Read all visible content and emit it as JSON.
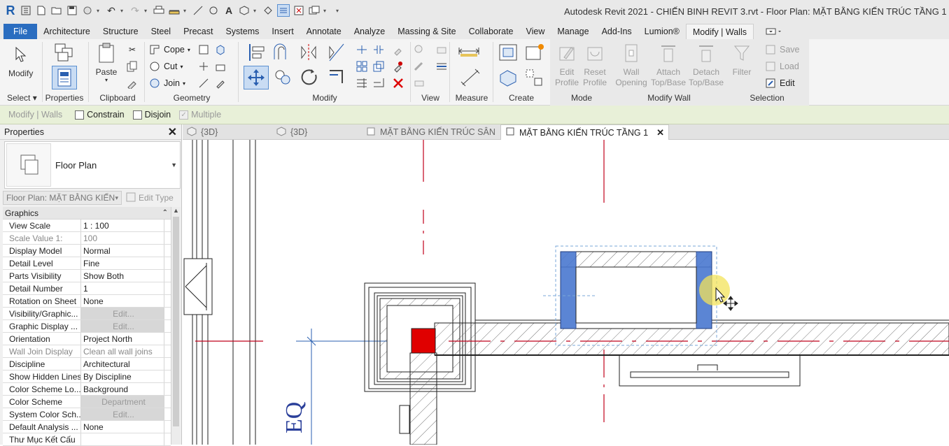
{
  "window": {
    "title": "Autodesk Revit 2021 - CHIẾN BINH REVIT 3.rvt - Floor Plan: MẶT BẰNG KIẾN TRÚC TẦNG 1"
  },
  "menu": {
    "file": "File",
    "tabs": [
      "Architecture",
      "Structure",
      "Steel",
      "Precast",
      "Systems",
      "Insert",
      "Annotate",
      "Analyze",
      "Massing & Site",
      "Collaborate",
      "View",
      "Manage",
      "Add-Ins",
      "Lumion®",
      "Modify | Walls"
    ]
  },
  "ribbon": {
    "select": {
      "modify": "Modify",
      "label": "Select"
    },
    "properties": {
      "label": "Properties"
    },
    "clipboard": {
      "paste": "Paste",
      "label": "Clipboard"
    },
    "geometry": {
      "cope": "Cope",
      "cut": "Cut",
      "join": "Join",
      "label": "Geometry"
    },
    "modify_label": "Modify",
    "view_label": "View",
    "measure_label": "Measure",
    "create_label": "Create",
    "mode": {
      "edit_profile": "Edit Profile",
      "reset_profile": "Reset Profile",
      "label": "Mode"
    },
    "modify_wall": {
      "wall_opening": "Wall Opening",
      "attach": "Attach Top/Base",
      "detach": "Detach Top/Base",
      "label": "Modify Wall"
    },
    "selection": {
      "filter": "Filter",
      "save": "Save",
      "load": "Load",
      "edit": "Edit",
      "label": "Selection"
    }
  },
  "options_bar": {
    "context": "Modify | Walls",
    "constrain": "Constrain",
    "disjoin": "Disjoin",
    "multiple": "Multiple"
  },
  "properties": {
    "title": "Properties",
    "type_name": "Floor Plan",
    "instance_selector": "Floor Plan: MẶT BẰNG KIẾN",
    "edit_type": "Edit Type",
    "category": "Graphics",
    "rows": [
      {
        "name": "View Scale",
        "value": "1 : 100"
      },
      {
        "name": "Scale Value    1:",
        "value": "100"
      },
      {
        "name": "Display Model",
        "value": "Normal"
      },
      {
        "name": "Detail Level",
        "value": "Fine"
      },
      {
        "name": "Parts Visibility",
        "value": "Show Both"
      },
      {
        "name": "Detail Number",
        "value": "1"
      },
      {
        "name": "Rotation on Sheet",
        "value": "None"
      },
      {
        "name": "Visibility/Graphic...",
        "value": "Edit..."
      },
      {
        "name": "Graphic Display ...",
        "value": "Edit..."
      },
      {
        "name": "Orientation",
        "value": "Project North"
      },
      {
        "name": "Wall Join Display",
        "value": "Clean all wall joins"
      },
      {
        "name": "Discipline",
        "value": "Architectural"
      },
      {
        "name": "Show Hidden Lines",
        "value": "By Discipline"
      },
      {
        "name": "Color Scheme Lo...",
        "value": "Background"
      },
      {
        "name": "Color Scheme",
        "value": "Department"
      },
      {
        "name": "System Color Sch...",
        "value": "Edit..."
      },
      {
        "name": "Default Analysis ...",
        "value": "None"
      },
      {
        "name": "Thư Mục Kết Cấu",
        "value": ""
      }
    ]
  },
  "view_tabs": [
    {
      "label": "{3D}"
    },
    {
      "label": "{3D}"
    },
    {
      "label": "MẶT BẰNG KIẾN TRÚC SÂN"
    },
    {
      "label": "MẶT BẰNG KIẾN TRÚC TẦNG 1"
    }
  ],
  "canvas": {
    "annotation": "EQ"
  },
  "colors": {
    "selected_wall": "#4a78d0",
    "red_element": "#e00000",
    "grid_line": "#c0001a"
  }
}
